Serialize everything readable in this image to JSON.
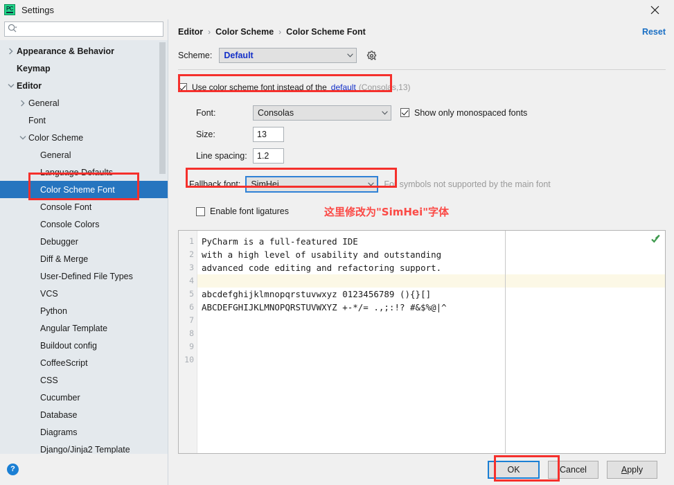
{
  "window": {
    "title": "Settings",
    "logo_text": "PC",
    "close_icon": "close-icon"
  },
  "sidebar": {
    "search": {
      "value": "",
      "placeholder": ""
    },
    "items": [
      {
        "label": "Appearance & Behavior",
        "indent": 0,
        "arrow": "right",
        "bold": true,
        "selected": false
      },
      {
        "label": "Keymap",
        "indent": 0,
        "arrow": "none",
        "bold": true,
        "selected": false
      },
      {
        "label": "Editor",
        "indent": 0,
        "arrow": "down",
        "bold": true,
        "selected": false
      },
      {
        "label": "General",
        "indent": 1,
        "arrow": "right",
        "bold": false,
        "selected": false
      },
      {
        "label": "Font",
        "indent": 1,
        "arrow": "none",
        "bold": false,
        "selected": false
      },
      {
        "label": "Color Scheme",
        "indent": 1,
        "arrow": "down",
        "bold": false,
        "selected": false
      },
      {
        "label": "General",
        "indent": 2,
        "arrow": "none",
        "bold": false,
        "selected": false
      },
      {
        "label": "Language Defaults",
        "indent": 2,
        "arrow": "none",
        "bold": false,
        "selected": false
      },
      {
        "label": "Color Scheme Font",
        "indent": 2,
        "arrow": "none",
        "bold": false,
        "selected": true
      },
      {
        "label": "Console Font",
        "indent": 2,
        "arrow": "none",
        "bold": false,
        "selected": false
      },
      {
        "label": "Console Colors",
        "indent": 2,
        "arrow": "none",
        "bold": false,
        "selected": false
      },
      {
        "label": "Debugger",
        "indent": 2,
        "arrow": "none",
        "bold": false,
        "selected": false
      },
      {
        "label": "Diff & Merge",
        "indent": 2,
        "arrow": "none",
        "bold": false,
        "selected": false
      },
      {
        "label": "User-Defined File Types",
        "indent": 2,
        "arrow": "none",
        "bold": false,
        "selected": false
      },
      {
        "label": "VCS",
        "indent": 2,
        "arrow": "none",
        "bold": false,
        "selected": false
      },
      {
        "label": "Python",
        "indent": 2,
        "arrow": "none",
        "bold": false,
        "selected": false
      },
      {
        "label": "Angular Template",
        "indent": 2,
        "arrow": "none",
        "bold": false,
        "selected": false
      },
      {
        "label": "Buildout config",
        "indent": 2,
        "arrow": "none",
        "bold": false,
        "selected": false
      },
      {
        "label": "CoffeeScript",
        "indent": 2,
        "arrow": "none",
        "bold": false,
        "selected": false
      },
      {
        "label": "CSS",
        "indent": 2,
        "arrow": "none",
        "bold": false,
        "selected": false
      },
      {
        "label": "Cucumber",
        "indent": 2,
        "arrow": "none",
        "bold": false,
        "selected": false
      },
      {
        "label": "Database",
        "indent": 2,
        "arrow": "none",
        "bold": false,
        "selected": false
      },
      {
        "label": "Diagrams",
        "indent": 2,
        "arrow": "none",
        "bold": false,
        "selected": false
      },
      {
        "label": "Django/Jinja2 Template",
        "indent": 2,
        "arrow": "none",
        "bold": false,
        "selected": false
      }
    ],
    "help_label": "?"
  },
  "breadcrumb": {
    "items": [
      "Editor",
      "Color Scheme",
      "Color Scheme Font"
    ],
    "separator": "›"
  },
  "header": {
    "reset_label": "Reset"
  },
  "scheme": {
    "label": "Scheme:",
    "value": "Default",
    "gear_icon": "gear-icon"
  },
  "use_scheme_font": {
    "checked": true,
    "text": "Use color scheme font instead of the",
    "link": "default",
    "suffix": "(Consolas,13)"
  },
  "form": {
    "font_label": "Font:",
    "font_value": "Consolas",
    "monospaced_label": "Show only monospaced fonts",
    "monospaced_checked": true,
    "size_label": "Size:",
    "size_value": "13",
    "line_spacing_label": "Line spacing:",
    "line_spacing_value": "1.2",
    "fallback_label": "Fallback font:",
    "fallback_value": "SimHei",
    "fallback_hint": "For symbols not supported by the main font",
    "ligatures_label": "Enable font ligatures",
    "ligatures_checked": false,
    "annotation": "这里修改为\"SimHei\"字体"
  },
  "preview": {
    "line_numbers": [
      "1",
      "2",
      "3",
      "4",
      "5",
      "6",
      "7",
      "8",
      "9",
      "10"
    ],
    "lines": [
      "PyCharm is a full-featured IDE",
      "with a high level of usability and outstanding",
      "advanced code editing and refactoring support.",
      "",
      "abcdefghijklmnopqrstuvwxyz 0123456789 (){}[]",
      "ABCDEFGHIJKLMNOPQRSTUVWXYZ +-*/= .,;:!? #&$%@|^",
      "",
      "",
      "",
      ""
    ],
    "caret_line_index": 3,
    "check_icon": "green-check-icon"
  },
  "buttons": {
    "ok": "OK",
    "cancel": "Cancel",
    "apply_prefix": "A",
    "apply_rest": "pply"
  },
  "colors": {
    "accent_blue": "#2675bf",
    "link_blue": "#1430c8",
    "reset_blue": "#1a6fc4",
    "annotation_red": "#f5302c",
    "caret_row": "#fcf8e6",
    "sidebar_bg": "#e4e9ed",
    "dialog_bg": "#f0f0f0"
  }
}
